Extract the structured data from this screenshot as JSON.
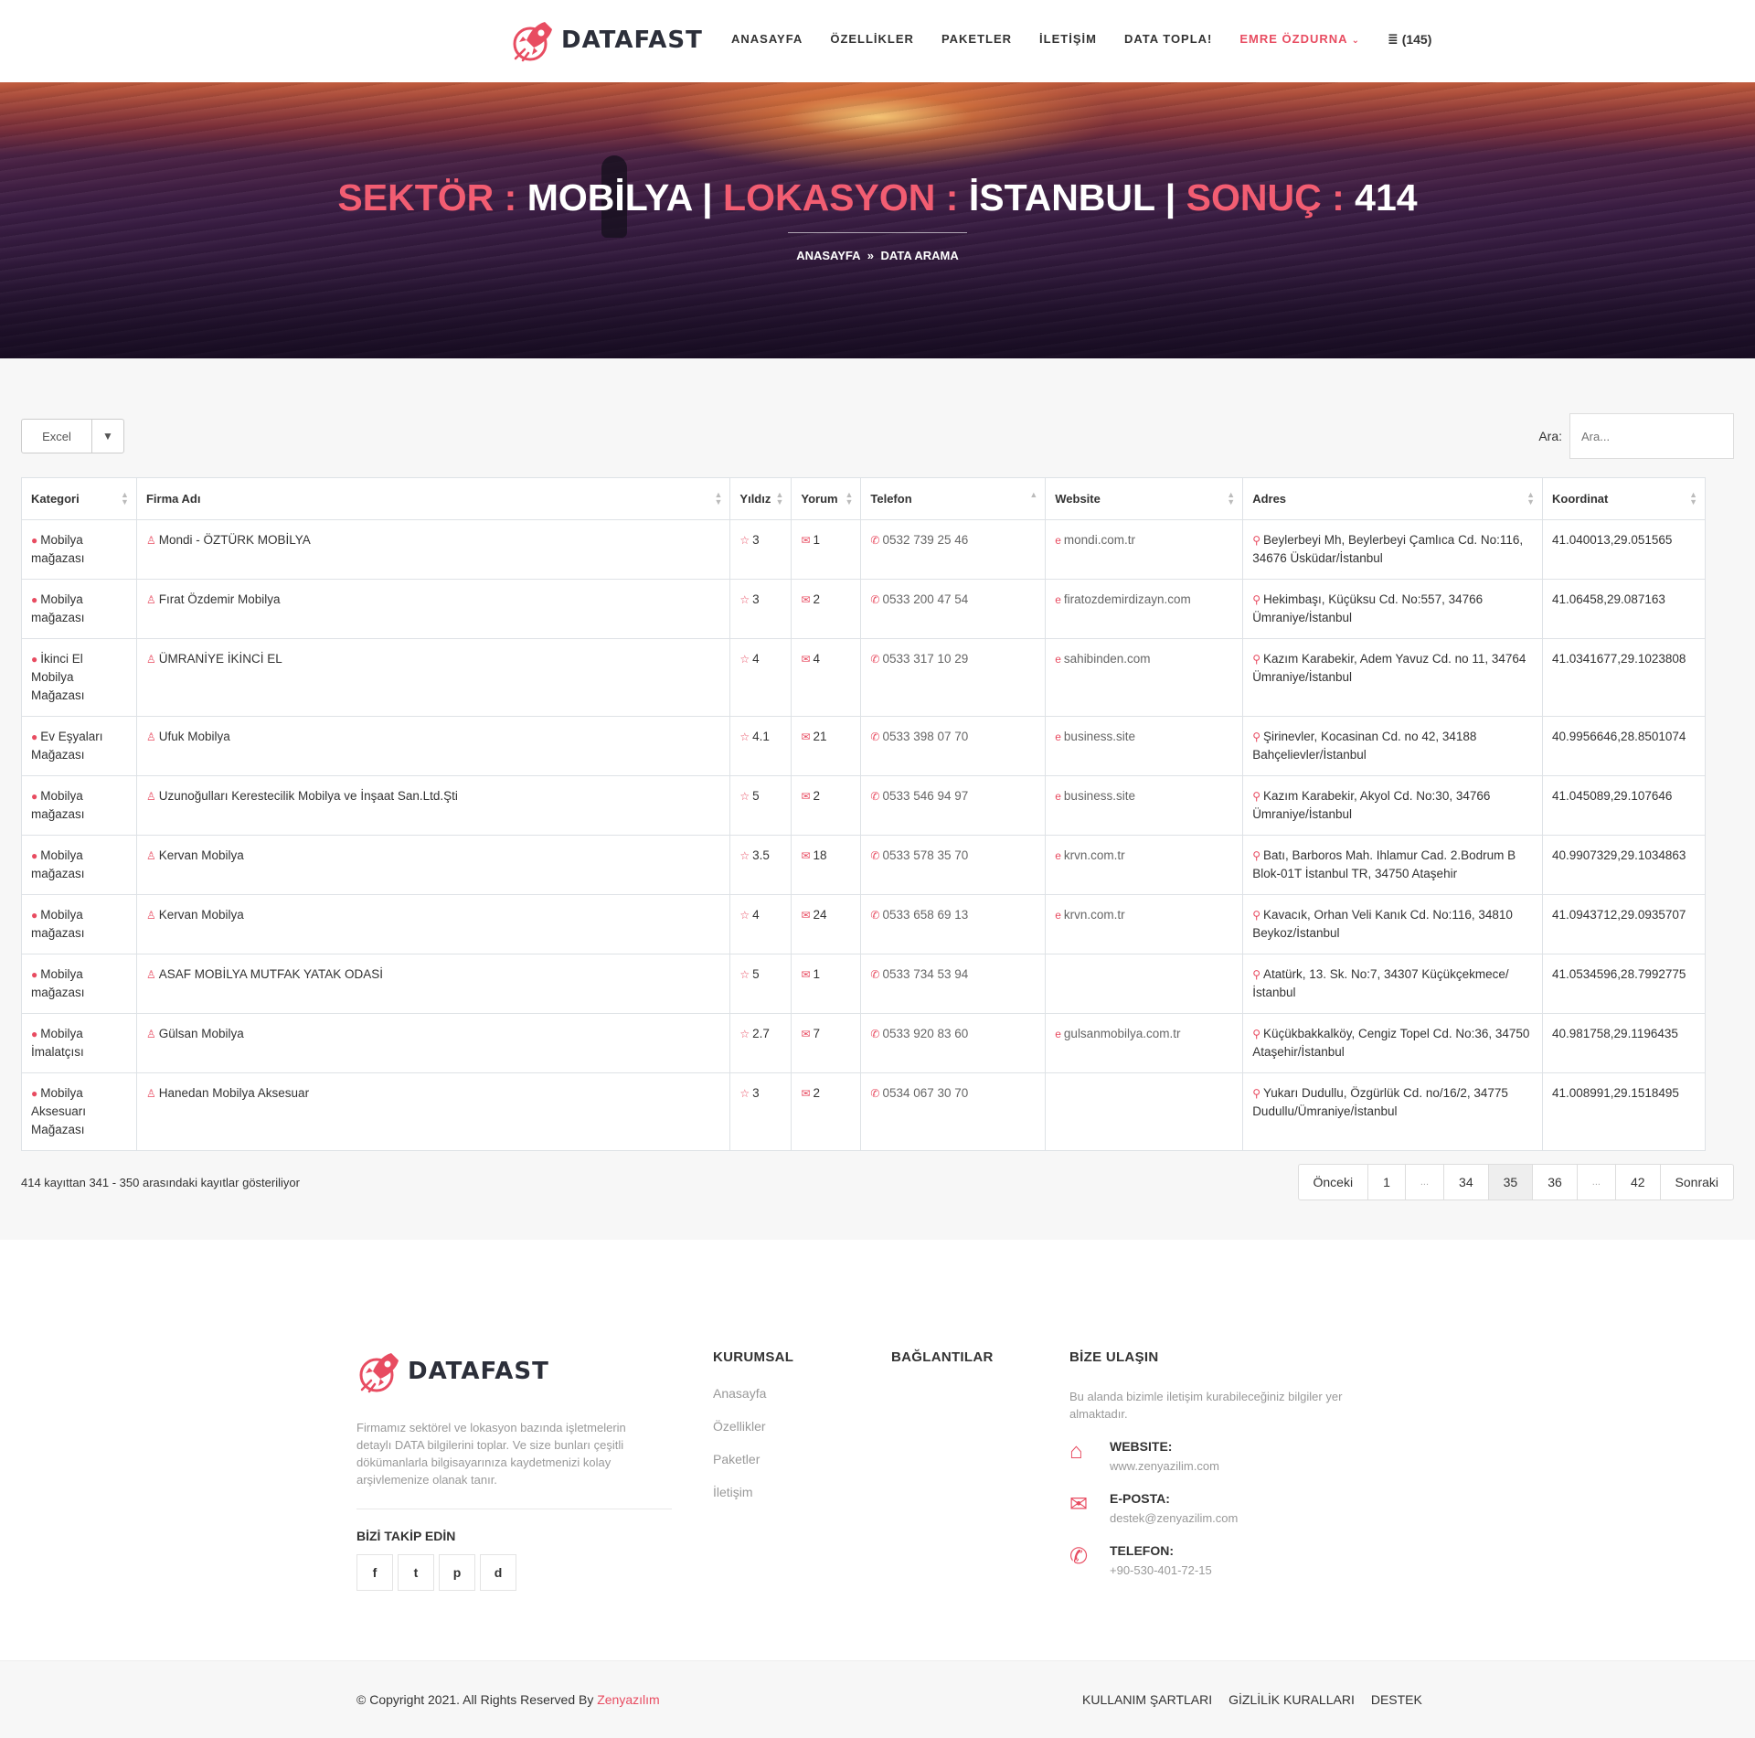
{
  "brand": {
    "name": "DATAFAST",
    "accent": "#e84c61"
  },
  "nav": {
    "items": [
      "ANASAYFA",
      "ÖZELLİKLER",
      "PAKETLER",
      "İLETİŞİM",
      "DATA TOPLA!"
    ],
    "user": "EMRE ÖZDURNA",
    "credits": "(145)"
  },
  "hero": {
    "sector_label": "SEKTÖR :",
    "sector_value": "MOBİLYA",
    "location_label": "LOKASYON :",
    "location_value": "İSTANBUL",
    "result_label": "SONUÇ :",
    "result_value": "414",
    "separator": "|",
    "breadcrumb_home": "ANASAYFA",
    "breadcrumb_sep": "»",
    "breadcrumb_current": "DATA ARAMA"
  },
  "toolbar": {
    "excel_label": "Excel",
    "excel_arrow": "▼",
    "search_label": "Ara:",
    "search_placeholder": "Ara..."
  },
  "table": {
    "headers": [
      "Kategori",
      "Firma Adı",
      "Yıldız",
      "Yorum",
      "Telefon",
      "Website",
      "Adres",
      "Koordinat"
    ],
    "rows": [
      {
        "kategori": "Mobilya mağazası",
        "firma": "Mondi - ÖZTÜRK MOBİLYA",
        "yildiz": "3",
        "yorum": "1",
        "telefon": "0532 739 25 46",
        "website": "mondi.com.tr",
        "adres": "Beylerbeyi Mh, Beylerbeyi Çamlıca Cd. No:116, 34676 Üsküdar/İstanbul",
        "koordinat": "41.040013,29.051565"
      },
      {
        "kategori": "Mobilya mağazası",
        "firma": "Fırat Özdemir Mobilya",
        "yildiz": "3",
        "yorum": "2",
        "telefon": "0533 200 47 54",
        "website": "firatozdemirdizayn.com",
        "adres": "Hekimbaşı, Küçüksu Cd. No:557, 34766 Ümraniye/İstanbul",
        "koordinat": "41.06458,29.087163"
      },
      {
        "kategori": "İkinci El Mobilya Mağazası",
        "firma": "ÜMRANİYE İKİNCİ EL",
        "yildiz": "4",
        "yorum": "4",
        "telefon": "0533 317 10 29",
        "website": "sahibinden.com",
        "adres": "Kazım Karabekir, Adem Yavuz Cd. no 11, 34764 Ümraniye/İstanbul",
        "koordinat": "41.0341677,29.1023808"
      },
      {
        "kategori": "Ev Eşyaları Mağazası",
        "firma": "Ufuk Mobilya",
        "yildiz": "4.1",
        "yorum": "21",
        "telefon": "0533 398 07 70",
        "website": "business.site",
        "adres": "Şirinevler, Kocasinan Cd. no 42, 34188 Bahçelievler/İstanbul",
        "koordinat": "40.9956646,28.8501074"
      },
      {
        "kategori": "Mobilya mağazası",
        "firma": "Uzunoğulları Kerestecilik Mobilya ve İnşaat San.Ltd.Şti",
        "yildiz": "5",
        "yorum": "2",
        "telefon": "0533 546 94 97",
        "website": "business.site",
        "adres": "Kazım Karabekir, Akyol Cd. No:30, 34766 Ümraniye/İstanbul",
        "koordinat": "41.045089,29.107646"
      },
      {
        "kategori": "Mobilya mağazası",
        "firma": "Kervan Mobilya",
        "yildiz": "3.5",
        "yorum": "18",
        "telefon": "0533 578 35 70",
        "website": "krvn.com.tr",
        "adres": "Batı, Barboros Mah. Ihlamur Cad. 2.Bodrum B Blok-01T İstanbul TR, 34750 Ataşehir",
        "koordinat": "40.9907329,29.1034863"
      },
      {
        "kategori": "Mobilya mağazası",
        "firma": "Kervan Mobilya",
        "yildiz": "4",
        "yorum": "24",
        "telefon": "0533 658 69 13",
        "website": "krvn.com.tr",
        "adres": "Kavacık, Orhan Veli Kanık Cd. No:116, 34810 Beykoz/İstanbul",
        "koordinat": "41.0943712,29.0935707"
      },
      {
        "kategori": "Mobilya mağazası",
        "firma": "ASAF MOBİLYA MUTFAK YATAK ODASİ",
        "yildiz": "5",
        "yorum": "1",
        "telefon": "0533 734 53 94",
        "website": "",
        "adres": "Atatürk, 13. Sk. No:7, 34307 Küçükçekmece/İstanbul",
        "koordinat": "41.0534596,28.7992775"
      },
      {
        "kategori": "Mobilya İmalatçısı",
        "firma": "Gülsan Mobilya",
        "yildiz": "2.7",
        "yorum": "7",
        "telefon": "0533 920 83 60",
        "website": "gulsanmobilya.com.tr",
        "adres": "Küçükbakkalköy, Cengiz Topel Cd. No:36, 34750 Ataşehir/İstanbul",
        "koordinat": "40.981758,29.1196435"
      },
      {
        "kategori": "Mobilya Aksesuarı Mağazası",
        "firma": "Hanedan Mobilya Aksesuar",
        "yildiz": "3",
        "yorum": "2",
        "telefon": "0534 067 30 70",
        "website": "",
        "adres": "Yukarı Dudullu, Özgürlük Cd. no/16/2, 34775 Dudullu/Ümraniye/İstanbul",
        "koordinat": "41.008991,29.1518495"
      }
    ],
    "info": "414 kayıttan 341 - 350 arasındaki kayıtlar gösteriliyor"
  },
  "pagination": {
    "prev": "Önceki",
    "pages": [
      "1",
      "...",
      "34",
      "35",
      "36",
      "...",
      "42"
    ],
    "active": "35",
    "next": "Sonraki"
  },
  "footer": {
    "brand": "DATAFAST",
    "description": "Firmamız sektörel ve lokasyon bazında işletmelerin detaylı DATA bilgilerini toplar. Ve size bunları çeşitli dökümanlarla bilgisayarınıza kaydetmenizi kolay arşivlemenize olanak tanır.",
    "follow_title": "BİZİ TAKİP EDİN",
    "social": [
      "f",
      "t",
      "p",
      "d"
    ],
    "kurumsal_title": "KURUMSAL",
    "kurumsal_links": [
      "Anasayfa",
      "Özellikler",
      "Paketler",
      "İletişim"
    ],
    "baglantilar_title": "BAĞLANTILAR",
    "contact_title": "BİZE ULAŞIN",
    "contact_desc": "Bu alanda bizimle iletişim kurabileceğiniz bilgiler yer almaktadır.",
    "website_label": "WEBSITE:",
    "website_value": "www.zenyazilim.com",
    "email_label": "E-POSTA:",
    "email_value": "destek@zenyazilim.com",
    "phone_label": "TELEFON:",
    "phone_value": "+90-530-401-72-15",
    "copyright": "© Copyright 2021. All Rights Reserved By",
    "copyright_brand": "Zenyazılım",
    "bottom_links": [
      "KULLANIM ŞARTLARI",
      "GİZLİLİK KURALLARI",
      "DESTEK"
    ]
  }
}
